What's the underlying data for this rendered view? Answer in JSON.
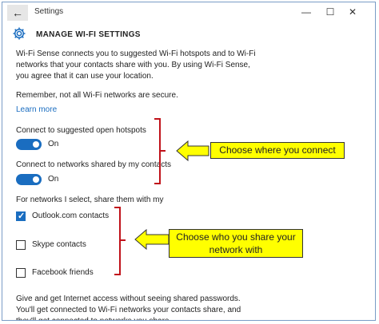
{
  "window": {
    "title": "Settings",
    "back_icon": "←",
    "minimize": "—",
    "maximize": "☐",
    "close": "✕"
  },
  "page": {
    "title": "MANAGE WI-FI SETTINGS",
    "gear_icon": "gear-icon"
  },
  "content": {
    "intro": "Wi-Fi Sense connects you to suggested Wi-Fi hotspots and to Wi-Fi networks that your contacts share with you. By using Wi-Fi Sense, you agree that it can use your location.",
    "remember": "Remember, not all Wi-Fi networks are secure.",
    "learn_more": "Learn more",
    "hotspots_label": "Connect to suggested open hotspots",
    "hotspots_state": "On",
    "shared_label": "Connect to networks shared by my contacts",
    "shared_state": "On",
    "share_header": "For networks I select, share them with my",
    "contacts": [
      {
        "label": "Outlook.com contacts",
        "checked": true
      },
      {
        "label": "Skype contacts",
        "checked": false
      },
      {
        "label": "Facebook friends",
        "checked": false
      }
    ],
    "footer": "Give and get Internet access without seeing shared passwords. You'll get connected to Wi-Fi networks your contacts share, and they'll get connected to networks you share."
  },
  "annotations": {
    "callout1": "Choose where you connect",
    "callout2": "Choose who you share your network with",
    "bracket_color": "#c0121a",
    "callout_color": "#ffff00"
  },
  "colors": {
    "accent": "#1a6dc0"
  }
}
